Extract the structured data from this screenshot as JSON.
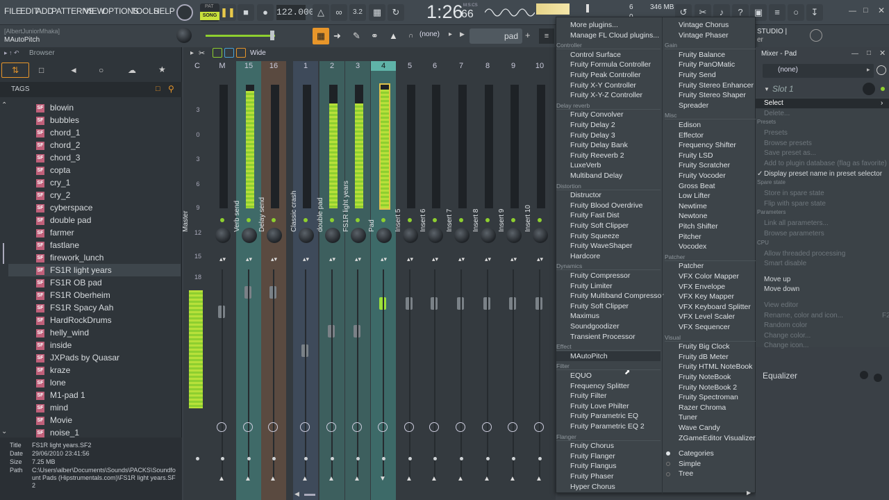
{
  "menu": [
    "FILE",
    "EDIT",
    "ADD",
    "PATTERNS",
    "VIEW",
    "OPTIONS",
    "TOOLS",
    "HELP"
  ],
  "transport": {
    "pat": "PAT",
    "song": "SONG",
    "tempo": "122.000",
    "time": "1:26",
    "time_small": "66",
    "time_label": "M:S:CS",
    "cpu_cores": "6",
    "memory": "346 MB",
    "cpu_line2": "0"
  },
  "hint": {
    "line1": "[AlbertJuniorMhaka]",
    "line2": "MAutoPitch"
  },
  "toolbar2": {
    "preset": "(none)",
    "pattern": "pad",
    "studio": "STUDIO |"
  },
  "browser": {
    "title": "Browser",
    "tags": "TAGS",
    "items": [
      "blowin",
      "bubbles",
      "chord_1",
      "chord_2",
      "chord_3",
      "copta",
      "cry_1",
      "cry_2",
      "cyberspace",
      "double pad",
      "farmer",
      "fastlane",
      "firework_lunch",
      "FS1R light years",
      "FS1R OB pad",
      "FS1R Oberheim",
      "FS1R Spacy Aah",
      "HardRockDrums",
      "helly_wind",
      "inside",
      "JXPads by Quasar",
      "kraze",
      "lone",
      "M1-pad 1",
      "mind",
      "Movie",
      "noise_1"
    ],
    "selected_index": 13,
    "info": {
      "title_k": "Title",
      "title_v": "FS1R light years.SF2",
      "date_k": "Date",
      "date_v": "29/06/2010 23:41:56",
      "size_k": "Size",
      "size_v": "7.25 MB",
      "path_k": "Path",
      "path_v": "C:\\Users\\alber\\Documents\\Sounds\\PACKS\\Soundfount Pads (Hipstrumentals.com)\\FS1R light years.SF2"
    }
  },
  "mixer": {
    "mode": "Wide",
    "scale": [
      "3",
      "0",
      "3",
      "6",
      "9",
      "12",
      "15",
      "18"
    ],
    "channels": [
      {
        "num": "C",
        "name": "Master"
      },
      {
        "num": "M",
        "name": ""
      },
      {
        "num": "15",
        "name": "Verb send"
      },
      {
        "num": "16",
        "name": "Delay send"
      },
      {
        "num": "1",
        "name": "Classic crash"
      },
      {
        "num": "2",
        "name": "double pad"
      },
      {
        "num": "3",
        "name": "FS1R light years"
      },
      {
        "num": "4",
        "name": "Pad"
      },
      {
        "num": "5",
        "name": "Insert 5"
      },
      {
        "num": "6",
        "name": "Insert 6"
      },
      {
        "num": "7",
        "name": "Insert 7"
      },
      {
        "num": "8",
        "name": "Insert 8"
      },
      {
        "num": "9",
        "name": "Insert 9"
      },
      {
        "num": "10",
        "name": "Insert 10"
      }
    ]
  },
  "plugin_menu": {
    "col1": [
      {
        "t": "item",
        "label": "More plugins..."
      },
      {
        "t": "item",
        "label": "Manage FL Cloud plugins..."
      },
      {
        "t": "sec",
        "label": "Controller"
      },
      {
        "t": "item",
        "label": "Control Surface"
      },
      {
        "t": "item",
        "label": "Fruity Formula Controller"
      },
      {
        "t": "item",
        "label": "Fruity Peak Controller"
      },
      {
        "t": "item",
        "label": "Fruity X-Y Controller"
      },
      {
        "t": "item",
        "label": "Fruity X-Y-Z Controller"
      },
      {
        "t": "sec",
        "label": "Delay reverb"
      },
      {
        "t": "item",
        "label": "Fruity Convolver"
      },
      {
        "t": "item",
        "label": "Fruity Delay 2"
      },
      {
        "t": "item",
        "label": "Fruity Delay 3"
      },
      {
        "t": "item",
        "label": "Fruity Delay Bank"
      },
      {
        "t": "item",
        "label": "Fruity Reeverb 2"
      },
      {
        "t": "item",
        "label": "LuxeVerb"
      },
      {
        "t": "item",
        "label": "Multiband Delay"
      },
      {
        "t": "sec",
        "label": "Distortion"
      },
      {
        "t": "item",
        "label": "Distructor"
      },
      {
        "t": "item",
        "label": "Fruity Blood Overdrive"
      },
      {
        "t": "item",
        "label": "Fruity Fast Dist"
      },
      {
        "t": "item",
        "label": "Fruity Soft Clipper"
      },
      {
        "t": "item",
        "label": "Fruity Squeeze"
      },
      {
        "t": "item",
        "label": "Fruity WaveShaper"
      },
      {
        "t": "item",
        "label": "Hardcore"
      },
      {
        "t": "sec",
        "label": "Dynamics"
      },
      {
        "t": "item",
        "label": "Fruity Compressor"
      },
      {
        "t": "item",
        "label": "Fruity Limiter"
      },
      {
        "t": "item",
        "label": "Fruity Multiband Compressor"
      },
      {
        "t": "item",
        "label": "Fruity Soft Clipper"
      },
      {
        "t": "item",
        "label": "Maximus"
      },
      {
        "t": "item",
        "label": "Soundgoodizer"
      },
      {
        "t": "item",
        "label": "Transient Processor"
      },
      {
        "t": "sec",
        "label": "Effect"
      },
      {
        "t": "item",
        "label": "MAutoPitch"
      },
      {
        "t": "sec",
        "label": "Filter"
      },
      {
        "t": "item",
        "label": "EQUO"
      },
      {
        "t": "item",
        "label": "Frequency Splitter"
      },
      {
        "t": "item",
        "label": "Fruity Filter"
      },
      {
        "t": "item",
        "label": "Fruity Love Philter"
      },
      {
        "t": "item",
        "label": "Fruity Parametric EQ"
      },
      {
        "t": "item",
        "label": "Fruity Parametric EQ 2"
      },
      {
        "t": "sec",
        "label": "Flanger"
      },
      {
        "t": "item",
        "label": "Fruity Chorus"
      },
      {
        "t": "item",
        "label": "Fruity Flanger"
      },
      {
        "t": "item",
        "label": "Fruity Flangus"
      },
      {
        "t": "item",
        "label": "Fruity Phaser"
      },
      {
        "t": "item",
        "label": "Hyper Chorus"
      }
    ],
    "col2": [
      {
        "t": "item",
        "label": "Vintage Chorus"
      },
      {
        "t": "item",
        "label": "Vintage Phaser"
      },
      {
        "t": "sec",
        "label": "Gain"
      },
      {
        "t": "item",
        "label": "Fruity Balance"
      },
      {
        "t": "item",
        "label": "Fruity PanOMatic"
      },
      {
        "t": "item",
        "label": "Fruity Send"
      },
      {
        "t": "item",
        "label": "Fruity Stereo Enhancer"
      },
      {
        "t": "item",
        "label": "Fruity Stereo Shaper"
      },
      {
        "t": "item",
        "label": "Spreader"
      },
      {
        "t": "sec",
        "label": "Misc"
      },
      {
        "t": "item",
        "label": "Edison"
      },
      {
        "t": "item",
        "label": "Effector"
      },
      {
        "t": "item",
        "label": "Frequency Shifter"
      },
      {
        "t": "item",
        "label": "Fruity LSD"
      },
      {
        "t": "item",
        "label": "Fruity Scratcher"
      },
      {
        "t": "item",
        "label": "Fruity Vocoder"
      },
      {
        "t": "item",
        "label": "Gross Beat"
      },
      {
        "t": "item",
        "label": "Low Lifter"
      },
      {
        "t": "item",
        "label": "Newtime"
      },
      {
        "t": "item",
        "label": "Newtone"
      },
      {
        "t": "item",
        "label": "Pitch Shifter"
      },
      {
        "t": "item",
        "label": "Pitcher"
      },
      {
        "t": "item",
        "label": "Vocodex"
      },
      {
        "t": "sec",
        "label": "Patcher"
      },
      {
        "t": "item",
        "label": "Patcher"
      },
      {
        "t": "item",
        "label": "VFX Color Mapper"
      },
      {
        "t": "item",
        "label": "VFX Envelope"
      },
      {
        "t": "item",
        "label": "VFX Key Mapper"
      },
      {
        "t": "item",
        "label": "VFX Keyboard Splitter"
      },
      {
        "t": "item",
        "label": "VFX Level Scaler"
      },
      {
        "t": "item",
        "label": "VFX Sequencer"
      },
      {
        "t": "sec",
        "label": "Visual"
      },
      {
        "t": "item",
        "label": "Fruity Big Clock"
      },
      {
        "t": "item",
        "label": "Fruity dB Meter"
      },
      {
        "t": "item",
        "label": "Fruity HTML NoteBook"
      },
      {
        "t": "item",
        "label": "Fruity NoteBook"
      },
      {
        "t": "item",
        "label": "Fruity NoteBook 2"
      },
      {
        "t": "item",
        "label": "Fruity Spectroman"
      },
      {
        "t": "item",
        "label": "Razer Chroma"
      },
      {
        "t": "item",
        "label": "Tuner"
      },
      {
        "t": "item",
        "label": "Wave Candy"
      },
      {
        "t": "item",
        "label": "ZGameEditor Visualizer"
      },
      {
        "t": "gap",
        "label": ""
      },
      {
        "t": "radio",
        "label": "Categories",
        "on": true
      },
      {
        "t": "radio",
        "label": "Simple",
        "on": false
      },
      {
        "t": "radio",
        "label": "Tree",
        "on": false
      }
    ]
  },
  "mixer_pad": {
    "title": "Mixer - Pad",
    "preset": "(none)",
    "slot": "Slot 1",
    "equalizer": "Equalizer",
    "context": [
      {
        "t": "item",
        "label": "Select",
        "hl": true
      },
      {
        "t": "dis",
        "label": "Delete..."
      },
      {
        "t": "sec",
        "label": "Presets"
      },
      {
        "t": "dis",
        "label": "Presets"
      },
      {
        "t": "dis",
        "label": "Browse presets"
      },
      {
        "t": "dis",
        "label": "Save preset as..."
      },
      {
        "t": "dis",
        "label": "Add to plugin database (flag as favorite)"
      },
      {
        "t": "check",
        "label": "Display preset name in preset selector"
      },
      {
        "t": "sec",
        "label": "Spare state"
      },
      {
        "t": "dis",
        "label": "Store in spare state"
      },
      {
        "t": "dis",
        "label": "Flip with spare state"
      },
      {
        "t": "sec",
        "label": "Parameters"
      },
      {
        "t": "dis",
        "label": "Link all parameters..."
      },
      {
        "t": "dis",
        "label": "Browse parameters"
      },
      {
        "t": "sec",
        "label": "CPU"
      },
      {
        "t": "dis",
        "label": "Allow threaded processing"
      },
      {
        "t": "dis",
        "label": "Smart disable"
      },
      {
        "t": "gap",
        "label": ""
      },
      {
        "t": "item",
        "label": "Move up"
      },
      {
        "t": "item",
        "label": "Move down"
      },
      {
        "t": "gap",
        "label": ""
      },
      {
        "t": "dis",
        "label": "View editor"
      },
      {
        "t": "dis",
        "label": "Rename, color and icon..."
      },
      {
        "t": "dis",
        "label": "Random color"
      },
      {
        "t": "dis",
        "label": "Change color..."
      },
      {
        "t": "dis",
        "label": "Change icon..."
      }
    ],
    "shortcut": "F2"
  }
}
